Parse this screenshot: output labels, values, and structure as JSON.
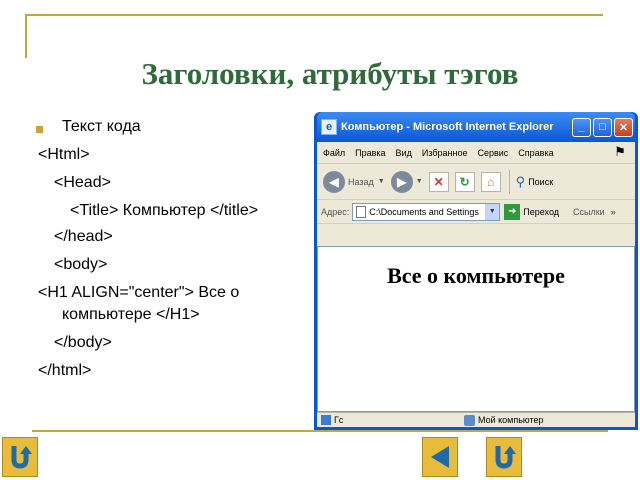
{
  "slide": {
    "title": "Заголовки, атрибуты тэгов",
    "code_lines": [
      "Текст кода",
      "<Html>",
      "<Head>",
      "<Title> Компьютер </title>",
      "</head>",
      "<body>",
      "<H1 ALIGN=\"center\"> Все о",
      "компьютере </H1>",
      "</body>",
      "</html>"
    ]
  },
  "browser": {
    "window_title": "Компьютер - Microsoft Internet Explorer",
    "window_buttons": {
      "minimize": "_",
      "maximize": "□",
      "close": "✕"
    },
    "menu": [
      "Файл",
      "Правка",
      "Вид",
      "Избранное",
      "Сервис",
      "Справка"
    ],
    "toolbar": {
      "back_label": "Назад",
      "search_label": "Поиск"
    },
    "address": {
      "label": "Адрес:",
      "value": "C:\\Documents and Settings",
      "go_label": "Переход",
      "links_label": "Ссылки"
    },
    "page_heading": "Все о компьютере",
    "status": {
      "left": "Гс",
      "zone": "Мой компьютер"
    }
  },
  "colors": {
    "title": "#2f6b3a",
    "accent": "#c9a437",
    "xp_blue": "#0a57d6",
    "nav_button": "#e8bc3a"
  },
  "nav": {
    "left_icon": "return-icon",
    "middle_icon": "previous-icon",
    "right_icon": "return-icon"
  }
}
